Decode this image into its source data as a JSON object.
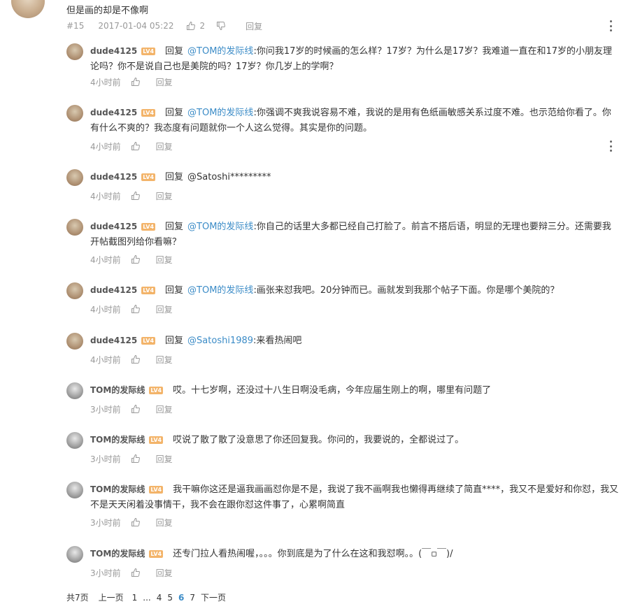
{
  "main_comment": {
    "text": "但是画的却是不像啊",
    "floor": "#15",
    "date": "2017-01-04 05:22",
    "likes": "2",
    "reply_label": "回复"
  },
  "reply_word": "回复",
  "replies": [
    {
      "user": "dude4125",
      "level": "LV4",
      "mention": "@TOM的发际线",
      "text": ":你问我17岁的时候画的怎么样？17岁？为什么是17岁？我难道一直在和17岁的小朋友理论吗？你不是说自己也是美院的吗？17岁？你几岁上的学啊？",
      "time": "4小时前",
      "reply_label": "回复"
    },
    {
      "user": "dude4125",
      "level": "LV4",
      "mention": "@TOM的发际线",
      "text": ":你强调不爽我说容易不难，我说的是用有色纸画敏感关系过度不难。也示范给你看了。你有什么不爽的？我态度有问题就你一个人这么觉得。其实是你的问题。",
      "time": "4小时前",
      "reply_label": "回复"
    },
    {
      "user": "dude4125",
      "level": "LV4",
      "mention": "",
      "text": "@Satoshi*********",
      "time": "4小时前",
      "reply_label": "回复"
    },
    {
      "user": "dude4125",
      "level": "LV4",
      "mention": "@TOM的发际线",
      "text": ":你自己的话里大多都已经自己打脸了。前言不搭后语，明显的无理也要辩三分。还需要我开帖截图列给你看嘛？",
      "time": "4小时前",
      "reply_label": "回复"
    },
    {
      "user": "dude4125",
      "level": "LV4",
      "mention": "@TOM的发际线",
      "text": ":画张来怼我吧。20分钟而已。画就发到我那个帖子下面。你是哪个美院的？",
      "time": "4小时前",
      "reply_label": "回复"
    },
    {
      "user": "dude4125",
      "level": "LV4",
      "mention": "@Satoshi1989",
      "text": ":来看热闹吧",
      "time": "4小时前",
      "reply_label": "回复"
    },
    {
      "user": "TOM的发际线",
      "level": "LV4",
      "mention": "",
      "text": "哎。十七岁啊，还没过十八生日啊没毛病，今年应届生刚上的啊，哪里有问题了",
      "time": "3小时前",
      "reply_label": "回复"
    },
    {
      "user": "TOM的发际线",
      "level": "LV4",
      "mention": "",
      "text": "哎说了散了散了没意思了你还回复我。你问的，我要说的，全都说过了。",
      "time": "3小时前",
      "reply_label": "回复"
    },
    {
      "user": "TOM的发际线",
      "level": "LV4",
      "mention": "",
      "text": "我干嘛你这还是逼我画画怼你是不是，我说了我不画啊我也懒得再继续了简直****，我又不是爱好和你怼，我又不是天天闲着没事情干，我不会在跟你怼这件事了，心累啊简直",
      "time": "3小时前",
      "reply_label": "回复"
    },
    {
      "user": "TOM的发际线",
      "level": "LV4",
      "mention": "",
      "text": "还专门拉人看热闹喔，。。。你到底是为了什么在这和我怼啊。。(￣▫￣)/",
      "time": "3小时前",
      "reply_label": "回复"
    }
  ],
  "pagination": {
    "total": "共7页",
    "prev": "上一页",
    "pages": [
      "1",
      "...",
      "4",
      "5",
      "6",
      "7"
    ],
    "current": "6",
    "next": "下一页"
  },
  "colors": {
    "mention": "#3c8cc7",
    "level_badge": "#f3b46a",
    "meta": "#999999"
  },
  "icons": [
    "thumbs-up-icon",
    "thumbs-down-icon",
    "more-vertical-icon"
  ]
}
